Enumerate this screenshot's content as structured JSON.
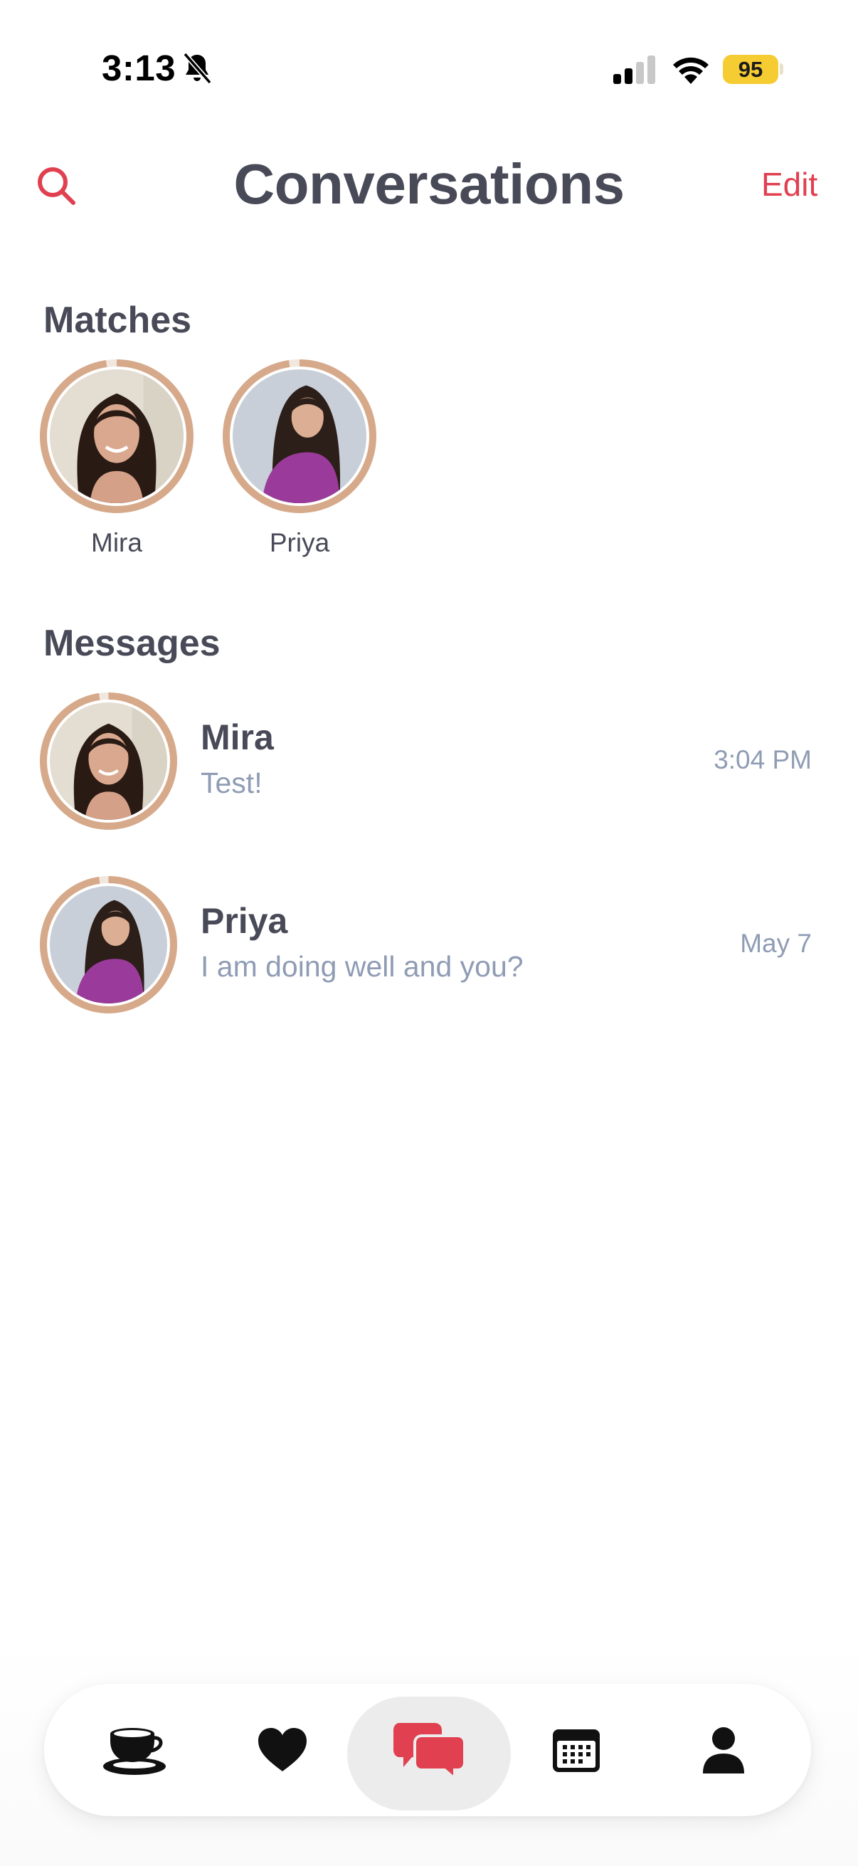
{
  "status_bar": {
    "time": "3:13",
    "battery": "95",
    "icons": [
      "bell-slash-icon",
      "signal-icon",
      "wifi-icon",
      "battery-icon"
    ]
  },
  "header": {
    "title": "Conversations",
    "edit_label": "Edit",
    "search_icon": "search-icon"
  },
  "matches": {
    "heading": "Matches",
    "items": [
      {
        "name": "Mira"
      },
      {
        "name": "Priya"
      }
    ]
  },
  "messages": {
    "heading": "Messages",
    "items": [
      {
        "name": "Mira",
        "preview": "Test!",
        "time": "3:04 PM"
      },
      {
        "name": "Priya",
        "preview": "I am doing well and you?",
        "time": "May 7"
      }
    ]
  },
  "nav": {
    "tabs": [
      {
        "icon": "coffee-cup-icon",
        "active": false
      },
      {
        "icon": "heart-icon",
        "active": false
      },
      {
        "icon": "chat-bubbles-icon",
        "active": true
      },
      {
        "icon": "calendar-icon",
        "active": false
      },
      {
        "icon": "person-icon",
        "active": false
      }
    ]
  },
  "colors": {
    "accent": "#e0404f",
    "title": "#484a58",
    "secondary_text": "#8f9cb4",
    "avatar_ring": "#d6a98a",
    "battery": "#f5cc32",
    "active_tab_bg": "#ececec"
  }
}
